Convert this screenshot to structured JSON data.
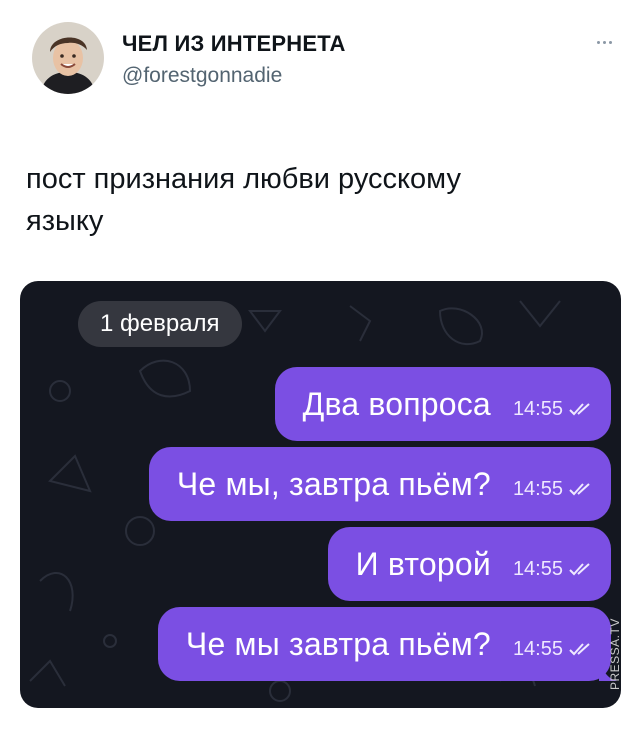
{
  "tweet": {
    "display_name": "ЧЕЛ ИЗ ИНТЕРНЕТА",
    "handle": "@forestgonnadie",
    "text_line1": "пост признания любви русскому",
    "text_line2": "языку"
  },
  "chat": {
    "date_label": "1 февраля",
    "messages": [
      {
        "text": "Два вопроса",
        "time": "14:55"
      },
      {
        "text": "Че мы, завтра пьём?",
        "time": "14:55"
      },
      {
        "text": "И второй",
        "time": "14:55"
      },
      {
        "text": "Че мы завтра пьём?",
        "time": "14:55"
      }
    ],
    "bubble_color": "#7b4fe3",
    "background_color": "#141720"
  },
  "watermark": "PRESSA.TV"
}
